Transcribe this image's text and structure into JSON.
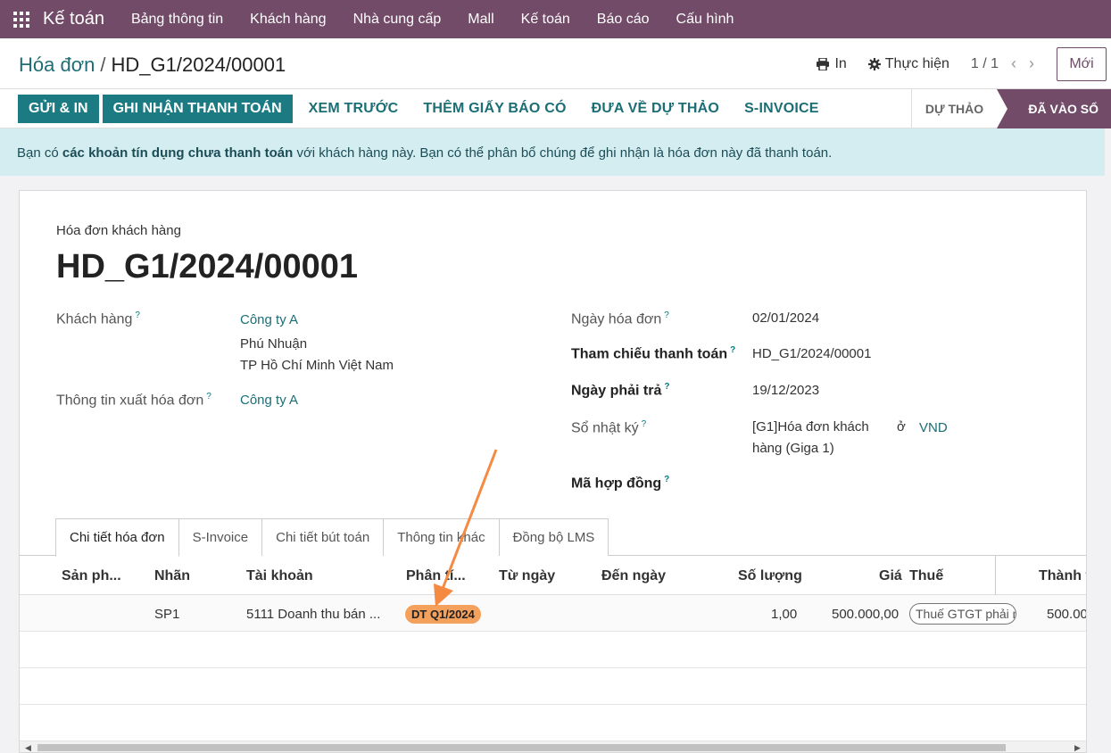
{
  "navbar": {
    "brand": "Kế toán",
    "items": [
      "Bảng thông tin",
      "Khách hàng",
      "Nhà cung cấp",
      "Mall",
      "Kế toán",
      "Báo cáo",
      "Cấu hình"
    ]
  },
  "control": {
    "breadcrumb_parent": "Hóa đơn",
    "breadcrumb_separator": "/",
    "breadcrumb_current": "HD_G1/2024/00001",
    "print_label": "In",
    "action_label": "Thực hiện",
    "pager": "1 / 1",
    "new_label": "Mới"
  },
  "actions": {
    "send_print": "GỬI & IN",
    "register_payment": "GHI NHẬN THANH TOÁN",
    "preview": "XEM TRƯỚC",
    "add_credit_note": "THÊM GIẤY BÁO CÓ",
    "reset_draft": "ĐƯA VỀ DỰ THẢO",
    "s_invoice": "S-INVOICE"
  },
  "stages": {
    "draft": "DỰ THẢO",
    "posted": "ĐÃ VÀO SỔ"
  },
  "alert": {
    "prefix": "Bạn có",
    "bold": "các khoản tín dụng chưa thanh toán",
    "suffix": "với khách hàng này. Bạn có thể phân bổ chúng để ghi nhận là hóa đơn này đã thanh toán."
  },
  "form": {
    "doc_type": "Hóa đơn khách hàng",
    "doc_name": "HD_G1/2024/00001",
    "customer_label": "Khách hàng",
    "customer_name": "Công ty A",
    "customer_addr1": "Phú Nhuận",
    "customer_addr2": "TP Hồ Chí Minh Việt Nam",
    "invoice_info_label": "Thông tin xuất hóa đơn",
    "invoice_info_value": "Công ty A",
    "invoice_date_label": "Ngày hóa đơn",
    "invoice_date": "02/01/2024",
    "payment_ref_label": "Tham chiếu thanh toán",
    "payment_ref": "HD_G1/2024/00001",
    "due_date_label": "Ngày phải trả",
    "due_date": "19/12/2023",
    "journal_label": "Sổ nhật ký",
    "journal_line1": "[G1]Hóa đơn khách",
    "journal_line2": "hàng (Giga 1)",
    "journal_in": "ở",
    "currency": "VND",
    "contract_label": "Mã hợp đồng",
    "help_mark": "?"
  },
  "tabs": [
    "Chi tiết hóa đơn",
    "S-Invoice",
    "Chi tiết bút toán",
    "Thông tin khác",
    "Đồng bộ LMS"
  ],
  "table": {
    "headers": [
      "Sản ph...",
      "Nhãn",
      "Tài khoản",
      "Phân tí...",
      "Từ ngày",
      "Đến ngày",
      "Số lượng",
      "Giá",
      "Thuế",
      "Thành t"
    ],
    "row": {
      "product": "",
      "label": "SP1",
      "account": "5111 Doanh thu bán ...",
      "analytic": "DT Q1/2024",
      "from_date": "",
      "to_date": "",
      "quantity": "1,00",
      "price": "500.000,00",
      "tax": "Thuế GTGT phải nộp",
      "subtotal": "500.00"
    }
  },
  "colors": {
    "brand": "#714b67",
    "primary": "#1b7a82",
    "alert_bg": "#d3edf0",
    "tag": "#f3a15c",
    "annotation": "#f58a42"
  }
}
